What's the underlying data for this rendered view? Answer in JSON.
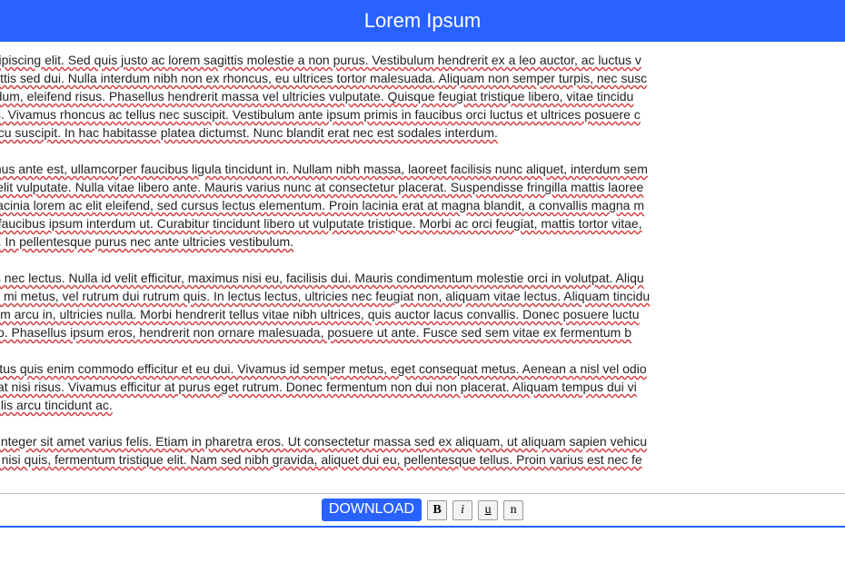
{
  "header": {
    "title": "Lorem Ipsum"
  },
  "paragraphs": [
    "t amet, consectetur adipiscing elit. Sed quis justo ac lorem sagittis molestie a non purus. Vestibulum hendrerit ex a leo auctor, ac luctus v\ns porta posuere et, mattis sed dui. Nulla interdum nibh non ex rhoncus, eu ultrices tortor malesuada. Aliquam non semper turpis, nec susc\n, hendrerit justo bibendum, eleifend risus. Phasellus hendrerit massa vel ultricies vulputate. Quisque feugiat tristique libero, vitae tincidu\nmauris rhoncus cursus. Vivamus rhoncus ac tellus nec suscipit. Vestibulum ante ipsum primis in faucibus orci luctus et ultrices posuere c\n dictum, nec feugiat arcu suscipit. In hac habitasse platea dictumst. Nunc blandit erat nec est sodales interdum.",
    "a. Pellentesque maximus ante est, ullamcorper faucibus ligula tincidunt in. Nullam nibh massa, laoreet facilisis nunc aliquet, interdum sem\nemper, sed faucibus velit vulputate. Nulla vitae libero ante. Mauris varius nunc at consectetur placerat. Suspendisse fringilla mattis laoree\nelerisque. Maecenas lacinia lorem ac elit eleifend, sed cursus lectus elementum. Proin lacinia erat at magna blandit, a convallis magna m\natis ipsum lectus, sed faucibus ipsum interdum ut. Curabitur tincidunt libero ut vulputate tristique. Morbi ac orci feugiat, mattis tortor vitae,\nte, sed vehicula lectus. In pellentesque purus nec ante ultricies vestibulum.",
    "s rhoncus semper quis nec lectus. Nulla id velit efficitur, maximus nisi eu, facilisis dui. Mauris condimentum molestie orci in volutpat. Aliqu\nat. Pellentesque mollis mi metus, vel rutrum dui rutrum quis. In lectus lectus, ultricies nec feugiat non, aliquam vitae lectus. Aliquam tincidu\nis congue, condimentum arcu in, ultricies nulla. Morbi hendrerit tellus vitae nibh ultrices, quis auctor lacus convallis. Donec posuere luctu\nis eu, ultricies nec justo. Phasellus ipsum eros, hendrerit non ornare malesuada, posuere ut ante. Fusce sed sem vitae ex fermentum b",
    "m neque. Donec id lectus quis enim commodo efficitur et eu dui. Vivamus id semper metus, eget consequat metus. Aenean a nisl vel odio\n eu nisl. Pellentesque at nisi risus. Vivamus efficitur at purus eget rutrum. Donec fermentum non dui non placerat. Aliquam tempus dui vi\nerdiet est, dapibus mollis arcu tincidunt ac.",
    "acus, ut facilisis eros. Integer sit amet varius felis. Etiam in pharetra eros. Ut consectetur massa sed ex aliquam, ut aliquam sapien vehicu\nodio risus, tempor nec nisi quis, fermentum tristique elit. Nam sed nibh gravida, aliquet dui eu, pellentesque tellus. Proin varius est nec fe"
  ],
  "toolbar": {
    "download_label": "DOWNLOAD",
    "bold_label": "B",
    "italic_label": "i",
    "underline_label": "u",
    "normal_label": "n"
  }
}
